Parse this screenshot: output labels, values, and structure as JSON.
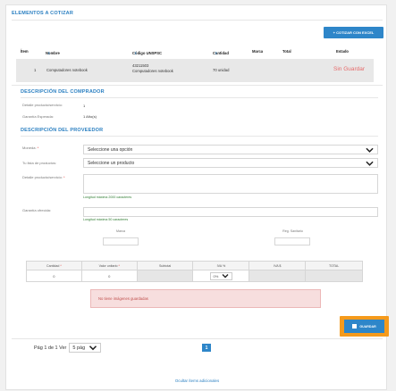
{
  "section": {
    "title": "ELEMENTOS A COTIZAR"
  },
  "toolbar": {
    "excel_button": "+ COTIZAR CON EXCEL"
  },
  "table": {
    "headers": {
      "item": "Ítem",
      "name": "Nombre",
      "code": "Código UNSPSC",
      "qty": "Cantidad",
      "brand": "Marca",
      "total": "Total",
      "status": "Estado"
    },
    "row": {
      "item": "1",
      "name": "Computadores notebook",
      "code": "43211503",
      "code_desc": "Computadores notebook",
      "qty": "70 unidad",
      "status": "Sin Guardar"
    }
  },
  "buyer": {
    "title": "DESCRIPCIÓN DEL COMPRADOR",
    "detail_label": "Detalle producto/servicio:",
    "detail_value": "1",
    "warranty_label": "Garantía Esperada:",
    "warranty_value": "1 Año(s)"
  },
  "provider": {
    "title": "DESCRIPCIÓN DEL PROVEEDOR",
    "currency_label": "Moneda:",
    "currency_value": "Seleccione una opción",
    "products_label": "Tu lista de productos:",
    "products_value": "Seleccione un producto",
    "detail_label": "Detalle producto/servicio:",
    "detail_hint": "Longitud máxima 2000 caracteres",
    "warranty_label": "Garantía ofrecida:",
    "warranty_hint": "Longitud máxima 50 caracteres",
    "brand_label": "Marca",
    "sanitary_label": "Reg. Sanitario"
  },
  "calc": {
    "headers": [
      "Cantidad",
      "Valor unitario",
      "Subtotal",
      "IVA %",
      "IVA $",
      "TOTAL"
    ],
    "qty_value": "0",
    "unit_value": "0",
    "iva_value": "0%"
  },
  "alert": {
    "text": "No tiene imágenes guardadas"
  },
  "save": {
    "label": "GUARDAR"
  },
  "pager": {
    "text": "Pág 1 de 1 Ver",
    "per_page": "5 pág",
    "page": "1"
  },
  "links": {
    "hide_items": "Ocultar ítems adicionales"
  },
  "colors": {
    "primary": "#2e86c9",
    "highlight": "#f59a1b",
    "error": "#e53935"
  }
}
